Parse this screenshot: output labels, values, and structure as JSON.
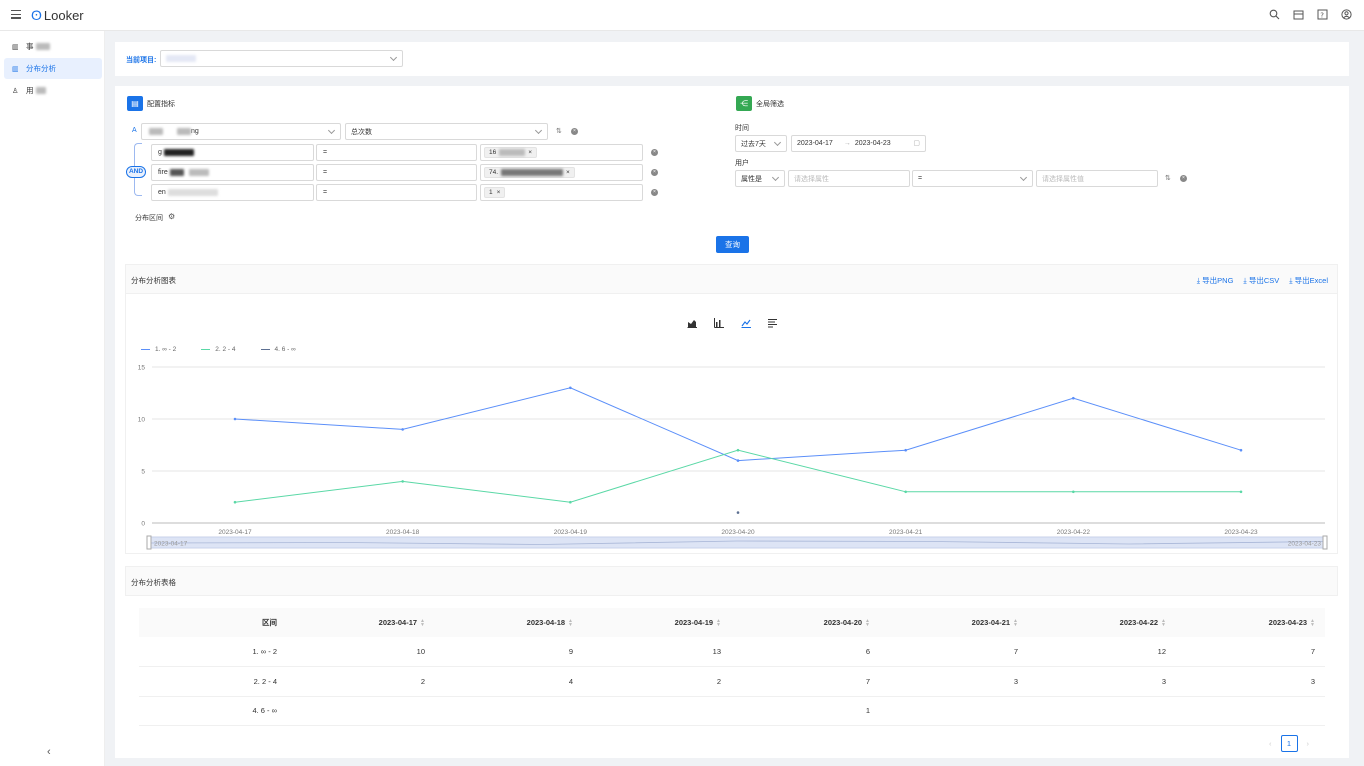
{
  "app": {
    "title": "Looker"
  },
  "sidebar": {
    "items": [
      {
        "label": "事",
        "active": false
      },
      {
        "label": "分布分析",
        "active": true
      },
      {
        "label": "用",
        "active": false
      }
    ]
  },
  "project": {
    "label": "当前项目:",
    "value": ""
  },
  "config": {
    "metric_button": "配置指标",
    "row_a_badge": "A",
    "event_select": "ng",
    "measure_select": "总次数",
    "and_badge": "AND",
    "conditions": [
      {
        "field": "g",
        "op": "=",
        "value": "16"
      },
      {
        "field": "fire",
        "op": "=",
        "value": "74."
      },
      {
        "field": "en",
        "op": "=",
        "value": "1"
      }
    ],
    "distribution_label": "分布区间",
    "query_button": "查询"
  },
  "filter": {
    "global_button": "全局筛选",
    "time_label": "时间",
    "time_preset": "过去7天",
    "start_date": "2023-04-17",
    "end_date": "2023-04-23",
    "date_sep": "→",
    "user_label": "用户",
    "attr_select": "属性是",
    "attr_placeholder": "请选择属性",
    "op_value": "=",
    "value_placeholder": "请选择属性值"
  },
  "chart_section": {
    "title": "分布分析图表",
    "exports": [
      "导出PNG",
      "导出CSV",
      "导出Excel"
    ]
  },
  "chart_data": {
    "type": "line",
    "categories": [
      "2023-04-17",
      "2023-04-18",
      "2023-04-19",
      "2023-04-20",
      "2023-04-21",
      "2023-04-22",
      "2023-04-23"
    ],
    "series": [
      {
        "name": "1. ∞ - 2",
        "color": "#5b8ff9",
        "values": [
          10,
          9,
          13,
          6,
          7,
          12,
          7
        ]
      },
      {
        "name": "2. 2 - 4",
        "color": "#5ad8a6",
        "values": [
          2,
          4,
          2,
          7,
          3,
          3,
          3
        ]
      },
      {
        "name": "4. 6 - ∞",
        "color": "#5d7092",
        "values": [
          null,
          null,
          null,
          1,
          null,
          null,
          null
        ]
      }
    ],
    "yticks": [
      0,
      5,
      10,
      15
    ],
    "ylim": [
      0,
      15
    ],
    "grid": true,
    "legend": "top-left",
    "slider": {
      "start": "2023-04-17",
      "end": "2023-04-23"
    }
  },
  "table_section": {
    "title": "分布分析表格",
    "header": [
      "区间",
      "2023-04-17",
      "2023-04-18",
      "2023-04-19",
      "2023-04-20",
      "2023-04-21",
      "2023-04-22",
      "2023-04-23"
    ],
    "rows": [
      [
        "1. ∞ - 2",
        "10",
        "9",
        "13",
        "6",
        "7",
        "12",
        "7"
      ],
      [
        "2. 2 - 4",
        "2",
        "4",
        "2",
        "7",
        "3",
        "3",
        "3"
      ],
      [
        "4. 6 - ∞",
        "",
        "",
        "",
        "1",
        "",
        "",
        ""
      ]
    ]
  },
  "pagination": {
    "current": "1",
    "prev": "‹",
    "next": "›"
  }
}
